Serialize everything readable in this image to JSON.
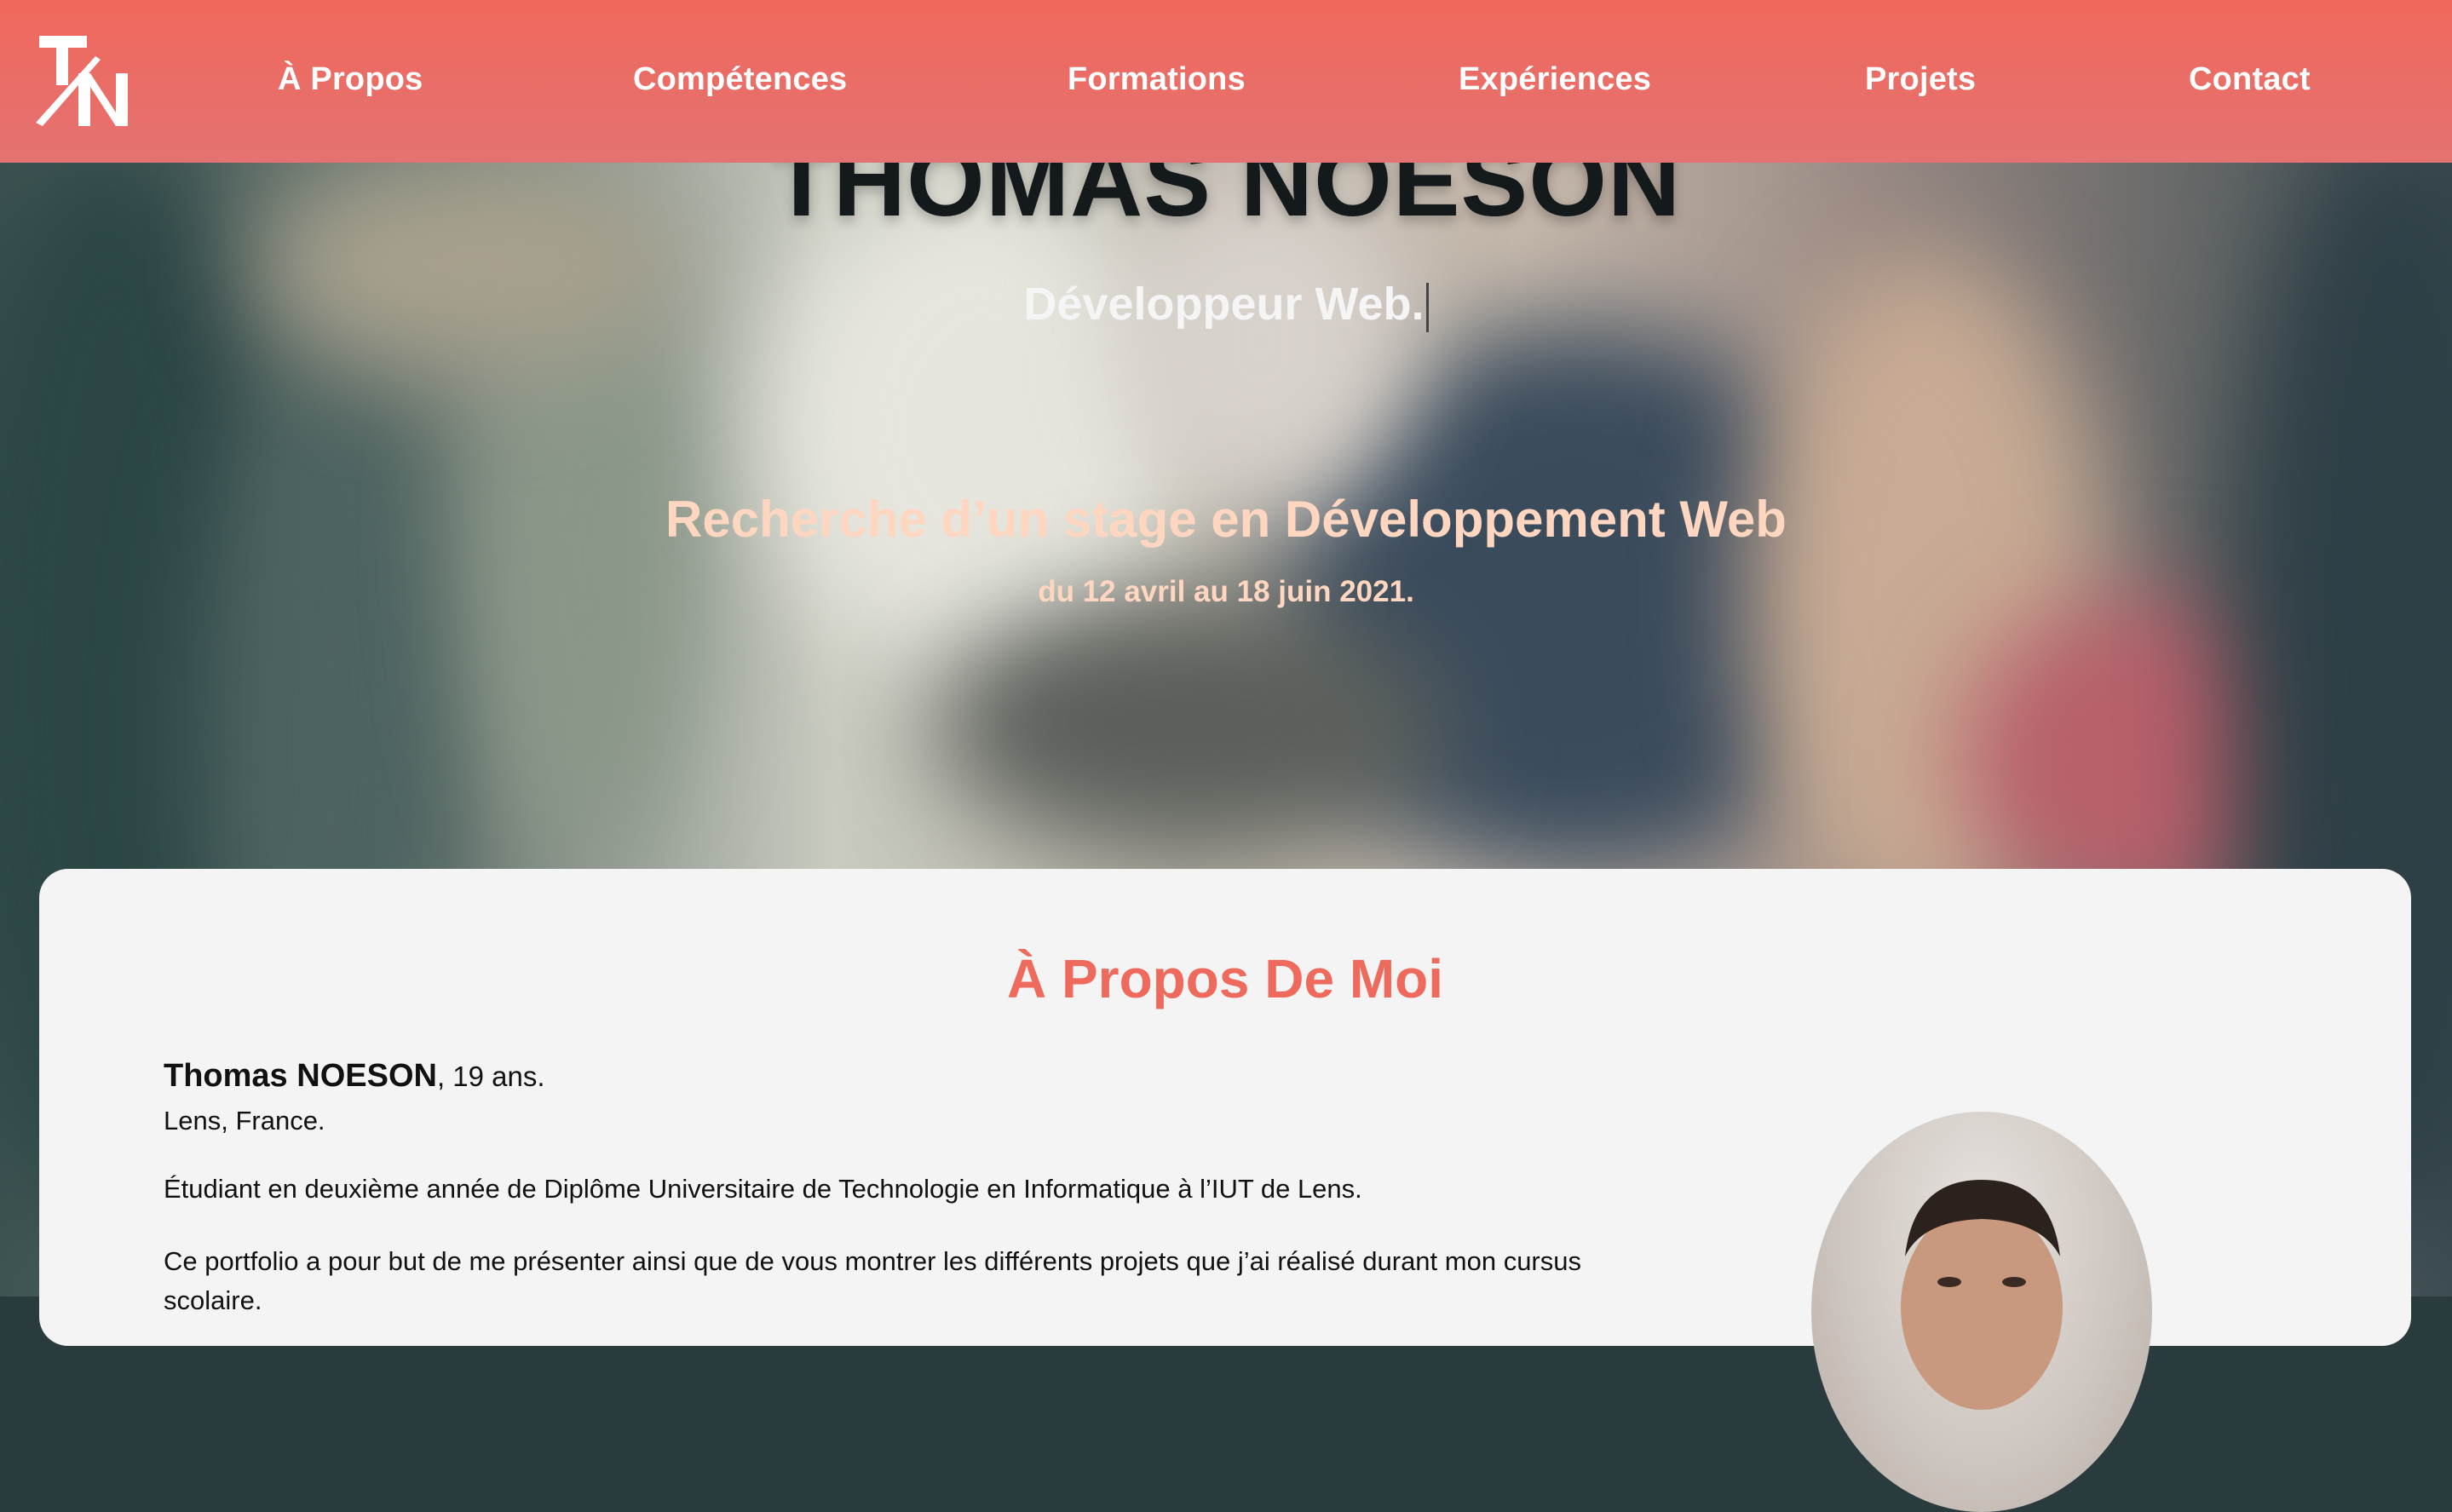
{
  "nav": {
    "items": [
      {
        "label": "À Propos"
      },
      {
        "label": "Compétences"
      },
      {
        "label": "Formations"
      },
      {
        "label": "Expériences"
      },
      {
        "label": "Projets"
      },
      {
        "label": "Contact"
      }
    ]
  },
  "hero": {
    "name": "THOMAS NOESON",
    "role": "Développeur Web.",
    "search": "Recherche d’un stage en Développement Web",
    "dates": "du 12 avril au 18 juin 2021."
  },
  "about": {
    "title": "À Propos De Moi",
    "name": "Thomas NOESON",
    "age": ", 19 ans.",
    "city": "Lens, France.",
    "paragraph1": "Étudiant en deuxième année de Diplôme Universitaire de Technologie en Informatique à l’IUT de Lens.",
    "paragraph2": "Ce portfolio a pour but de me présenter ainsi que de vous montrer les différents projets que j’ai réalisé durant mon cursus scolaire."
  },
  "colors": {
    "accent": "#ee6a5c",
    "navbar": "#f0685b",
    "hero_highlight": "#ffd6c0",
    "card_bg": "#f4f4f4"
  },
  "icons": {
    "logo": "tn-logo-icon"
  }
}
